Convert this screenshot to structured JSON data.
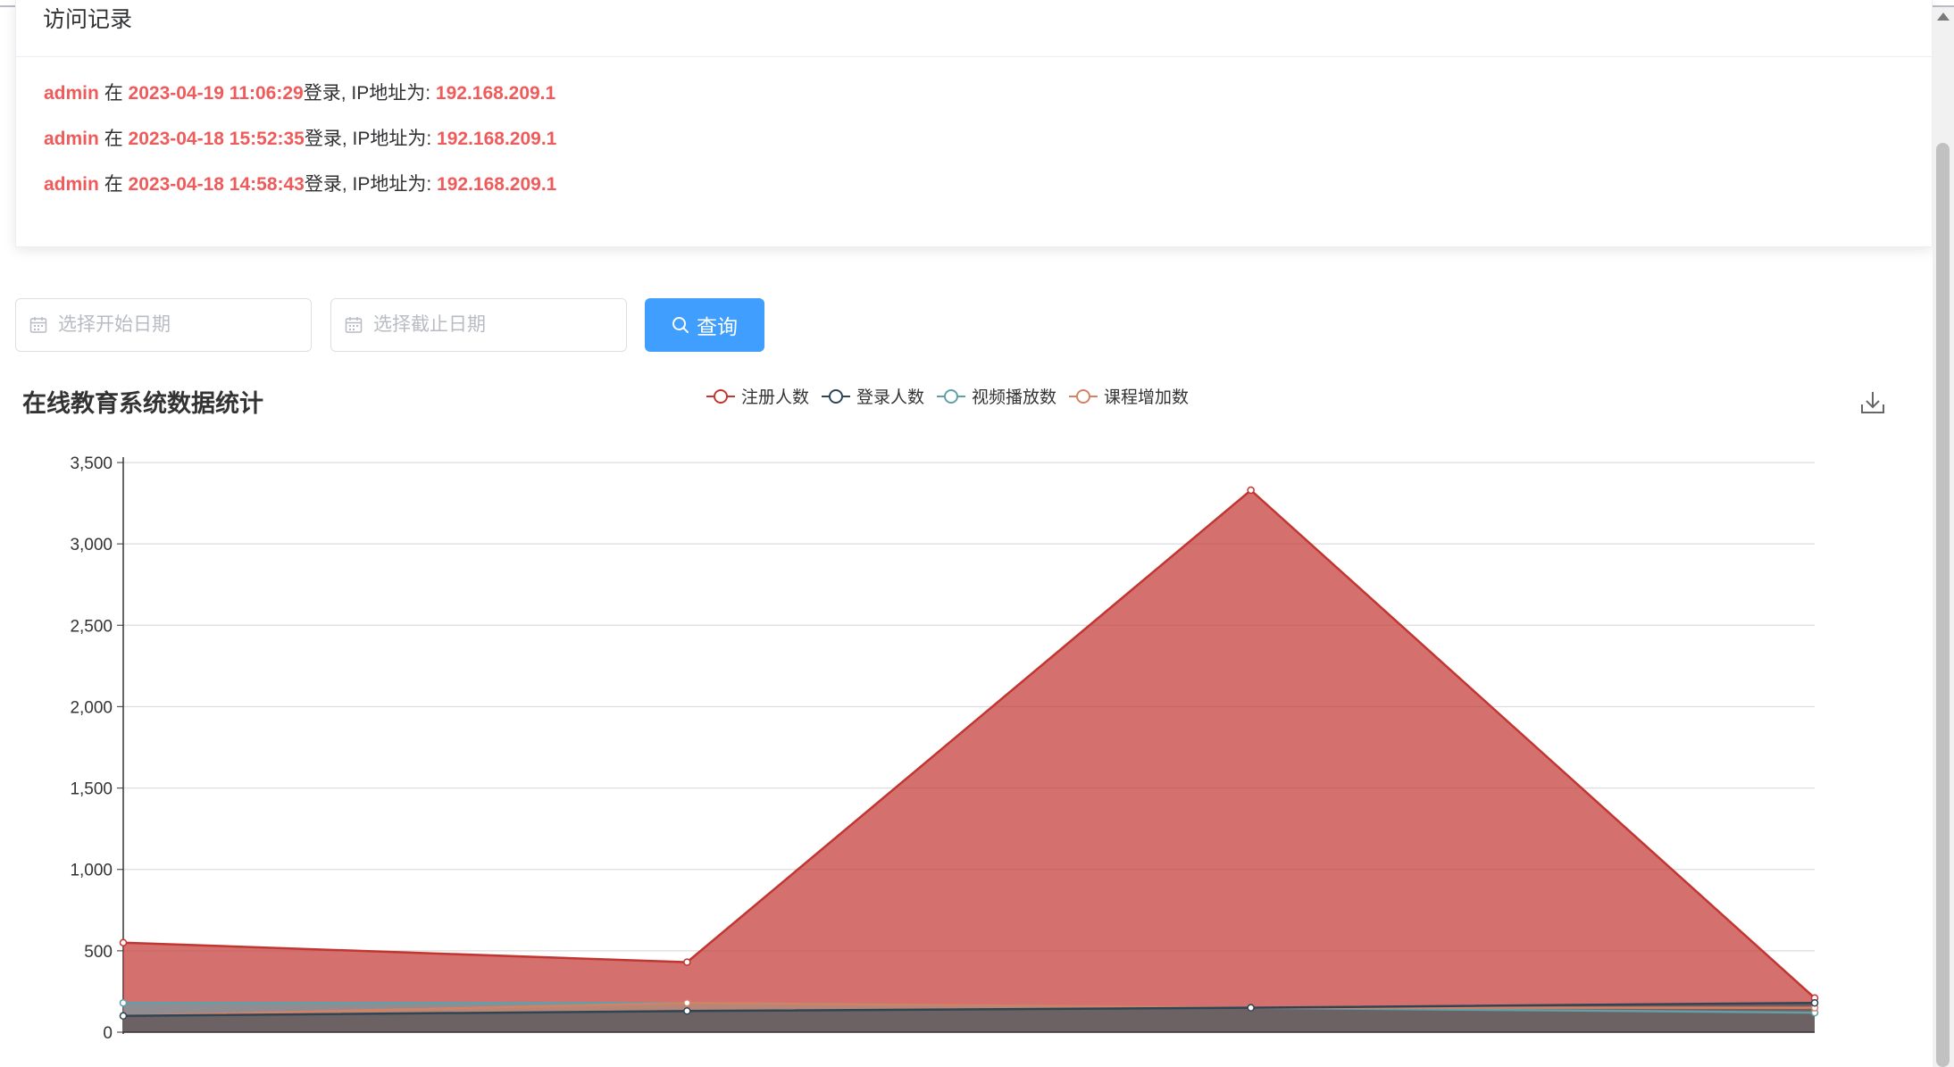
{
  "visit_log": {
    "title": "访问记录",
    "at_word": "在",
    "login_text": "登录, IP地址为: ",
    "entries": [
      {
        "user": "admin",
        "time": "2023-04-19 11:06:29",
        "ip": "192.168.209.1"
      },
      {
        "user": "admin",
        "time": "2023-04-18 15:52:35",
        "ip": "192.168.209.1"
      },
      {
        "user": "admin",
        "time": "2023-04-18 14:58:43",
        "ip": "192.168.209.1"
      }
    ]
  },
  "filter": {
    "start_placeholder": "选择开始日期",
    "end_placeholder": "选择截止日期",
    "search_label": "查询"
  },
  "chart_data": {
    "type": "area",
    "title": "在线教育系统数据统计",
    "xlabel": "",
    "ylabel": "",
    "ylim": [
      0,
      3500
    ],
    "yticks": [
      "0",
      "500",
      "1,000",
      "1,500",
      "2,000",
      "2,500",
      "3,000",
      "3,500"
    ],
    "x_count": 4,
    "grid": true,
    "legend_position": "top",
    "series": [
      {
        "name": "注册人数",
        "color": "#c23531",
        "values": [
          550,
          430,
          3330,
          210
        ]
      },
      {
        "name": "登录人数",
        "color": "#2f4554",
        "values": [
          100,
          130,
          150,
          180
        ]
      },
      {
        "name": "视频播放数",
        "color": "#61a0a8",
        "values": [
          180,
          180,
          150,
          120
        ]
      },
      {
        "name": "课程增加数",
        "color": "#d48265",
        "values": [
          100,
          180,
          150,
          150
        ]
      }
    ]
  },
  "icons": {
    "download": "download-icon",
    "calendar": "calendar-icon",
    "search": "search-icon"
  }
}
